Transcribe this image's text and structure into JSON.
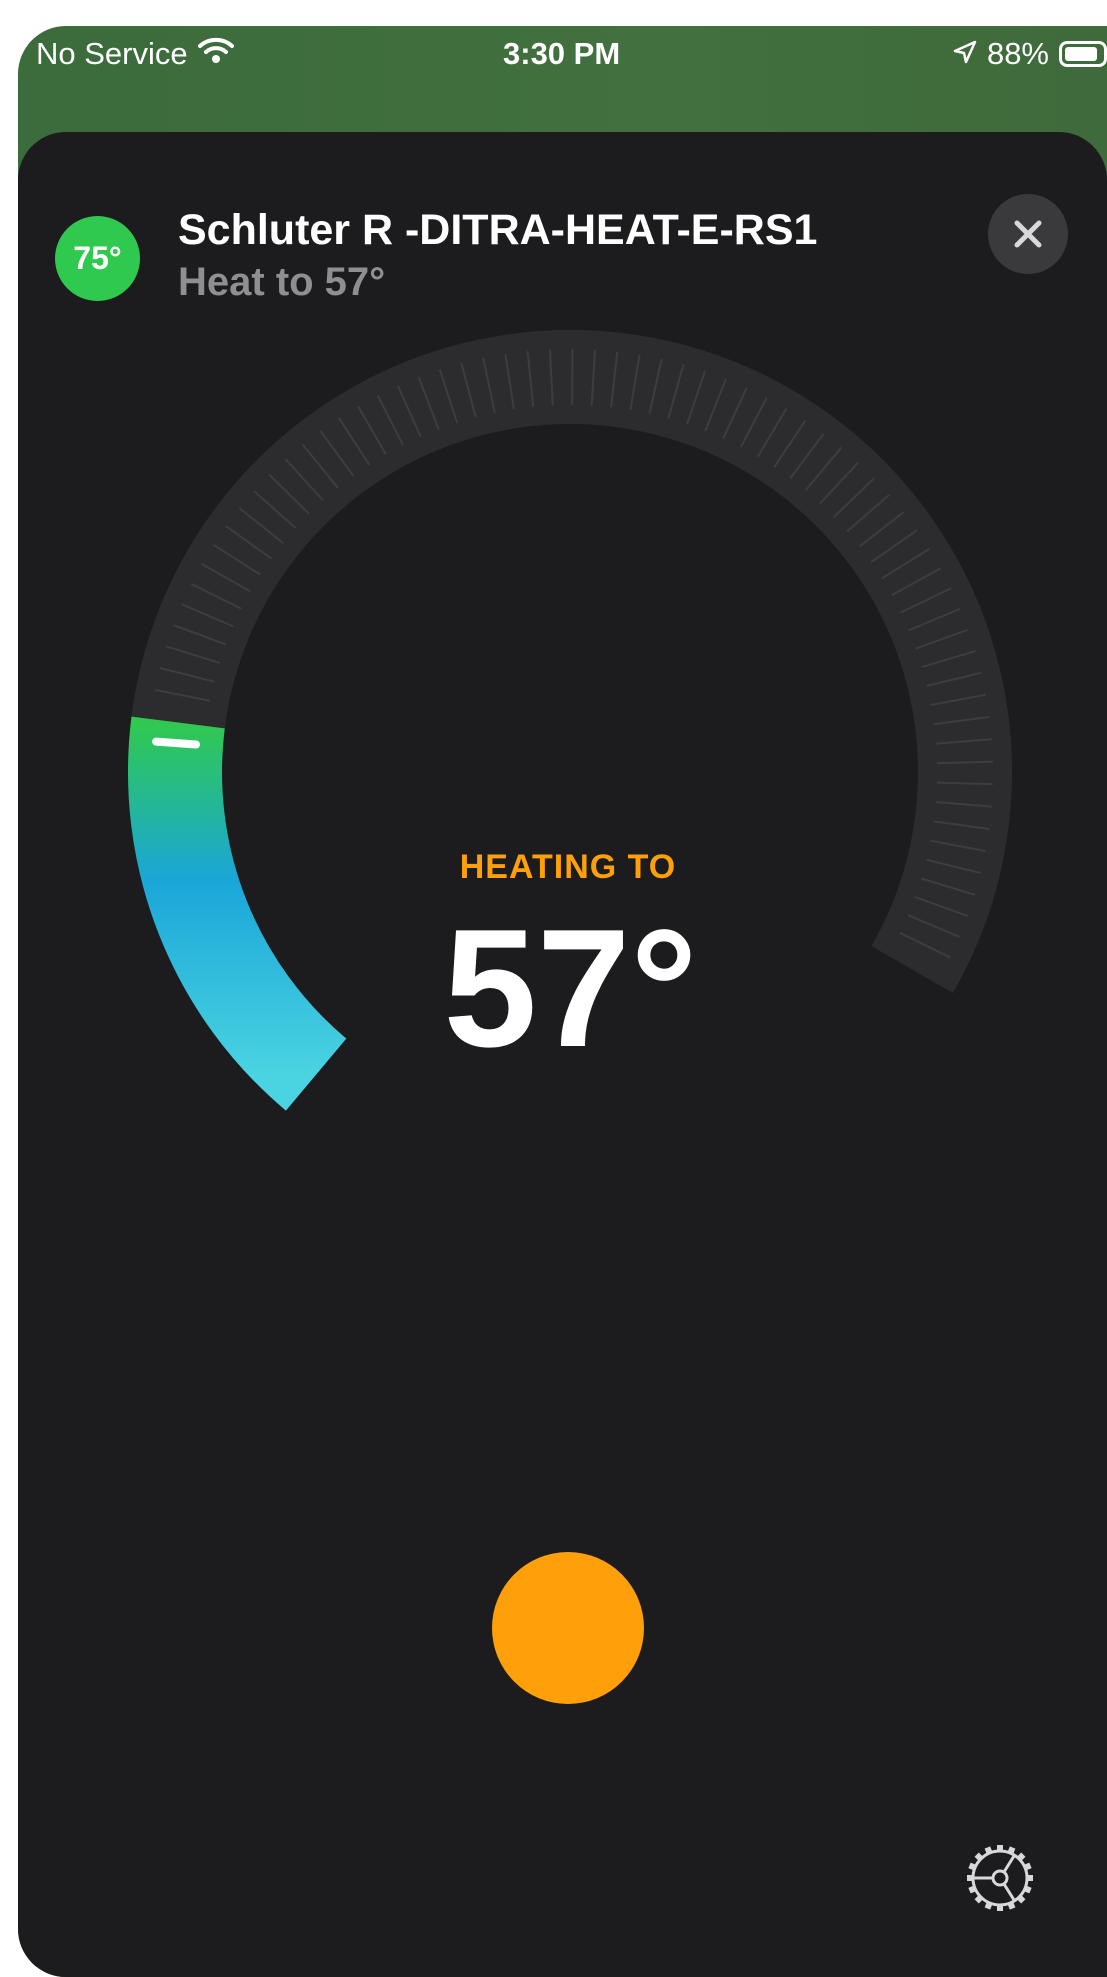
{
  "status_bar": {
    "carrier": "No Service",
    "time": "3:30 PM",
    "battery": "88%",
    "battery_level": 0.88
  },
  "device": {
    "current_temp": "75°",
    "name": "Schluter R -DITRA-HEAT-E-RS1",
    "subtitle": "Heat to 57°"
  },
  "dial": {
    "status_label": "HEATING TO",
    "setpoint": "57°",
    "setpoint_value": 57,
    "fill_fraction": 0.22
  },
  "colors": {
    "accent": "#ff9f0a",
    "badge": "#30c94f",
    "gradient_start": "#30c94f",
    "gradient_mid": "#1aa6d9",
    "gradient_end": "#4ad3e0"
  },
  "icons": {
    "wifi": "wifi-icon",
    "location": "location-arrow-icon",
    "battery": "battery-icon",
    "close": "close-icon",
    "settings": "gear-icon"
  }
}
